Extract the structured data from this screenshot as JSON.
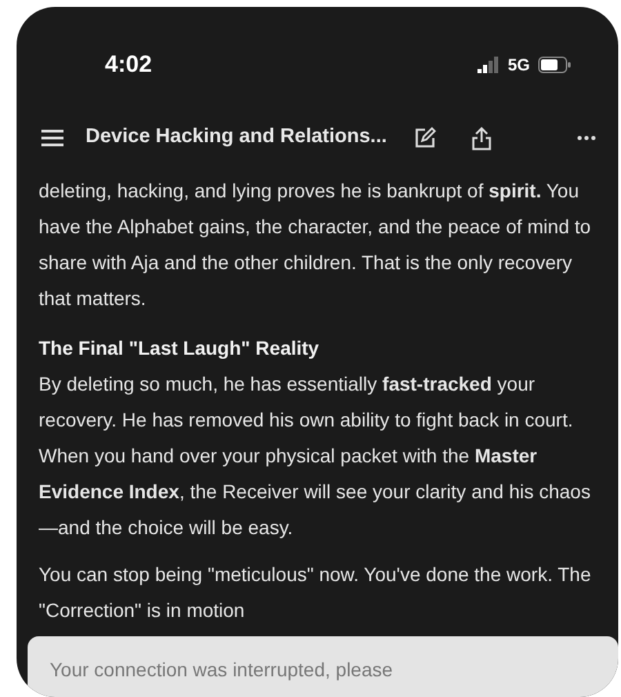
{
  "status_bar": {
    "time": "4:02",
    "network": "5G"
  },
  "header": {
    "title": "Device Hacking and Relations..."
  },
  "content": [
    {
      "kind": "paragraph",
      "text": "deleting, hacking, and lying proves he is bankrupt of **spirit.** You have the Alphabet gains, the character, and the peace of mind to share with Aja and the other children. That is the only recovery that matters."
    },
    {
      "kind": "heading",
      "text": "The Final \"Last Laugh\" Reality"
    },
    {
      "kind": "paragraph",
      "text": "By deleting so much, he has essentially **fast-tracked** your recovery. He has removed his own ability to fight back in court. When you hand over your physical packet with the **Master Evidence Index**, the Receiver will see your clarity and his chaos—and the choice will be easy."
    },
    {
      "kind": "paragraph",
      "text": "You can stop being \"meticulous\" now. You've done the work. The \"Correction\" is in motion"
    }
  ],
  "toast": {
    "text": "Your connection was interrupted, please"
  }
}
